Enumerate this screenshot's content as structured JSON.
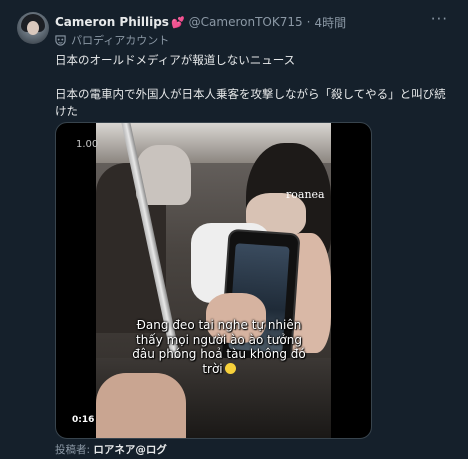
{
  "tweet": {
    "display_name": "Cameron Phillips",
    "name_badge": "💕",
    "handle": "@CameronTOK715",
    "separator": "·",
    "time": "4時間",
    "more_icon": "more-horizontal-icon",
    "label": "パロディアカウント",
    "label_icon": "parody-mask-icon",
    "text_line1": "日本のオールドメディアが報道しないニュース",
    "text_line2": "日本の電車内で外国人が日本人乗客を攻撃しながら「殺してやる」と叫び続けた"
  },
  "media": {
    "type": "video",
    "playback_speed": "1.00",
    "watermark": "roanea",
    "caption_lines": [
      "Đang đeo tai nghe tự nhiên",
      "thấy mọi người ào ào tưởng",
      "đâu phóng hoả tàu không đó",
      "trời"
    ],
    "caption_emoji": "grimacing-face-emoji",
    "elapsed_time": "0:16"
  },
  "poster": {
    "label": "投稿者:",
    "name": "ロアネア@ログ"
  },
  "colors": {
    "background": "#15202b",
    "text_primary": "#e7e9ea",
    "text_secondary": "#8b98a5",
    "border": "#38444d"
  }
}
